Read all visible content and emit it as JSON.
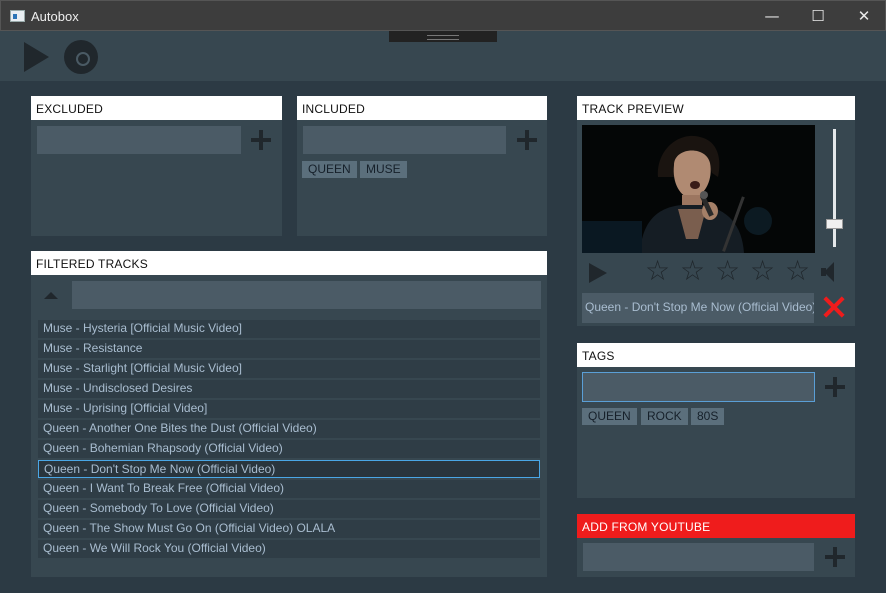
{
  "window": {
    "title": "Autobox",
    "min_glyph": "—",
    "max_glyph": "☐",
    "close_glyph": "✕"
  },
  "toolbar": {
    "play_icon": "play-icon",
    "disc_icon": "vinyl-disc-icon"
  },
  "excluded": {
    "title": "EXCLUDED",
    "input_value": "",
    "tags": []
  },
  "included": {
    "title": "INCLUDED",
    "input_value": "",
    "tags": [
      "QUEEN",
      "MUSE"
    ]
  },
  "filtered": {
    "title": "FILTERED TRACKS",
    "search_value": "",
    "tracks": [
      "Muse - Hysteria [Official Music Video]",
      "Muse - Resistance",
      "Muse - Starlight [Official Music Video]",
      "Muse - Undisclosed Desires",
      "Muse - Uprising [Official Video]",
      "Queen - Another One Bites the Dust (Official Video)",
      "Queen - Bohemian Rhapsody (Official Video)",
      "Queen - Don't Stop Me Now (Official Video)",
      "Queen - I Want To Break Free (Official Video)",
      "Queen - Somebody To Love (Official Video)",
      "Queen - The Show Must Go On (Official Video) OLALA",
      "Queen - We Will Rock You (Official Video)"
    ],
    "selected_index": 7
  },
  "preview": {
    "title": "TRACK PREVIEW",
    "now_playing": "Queen - Don't Stop Me Now (Official Video)",
    "rating": 0,
    "rating_max": 5,
    "volume": 0.17,
    "star_glyph": "☆"
  },
  "tags": {
    "title": "TAGS",
    "input_value": "",
    "items": [
      "QUEEN",
      "ROCK",
      "80S"
    ]
  },
  "youtube": {
    "title": "ADD FROM YOUTUBE",
    "input_value": ""
  },
  "colors": {
    "accent_red": "#ef1c1c",
    "panel": "#374750",
    "field": "#4b5b66",
    "track_text": "#a9bdd0",
    "selection": "#4aa7e6"
  }
}
